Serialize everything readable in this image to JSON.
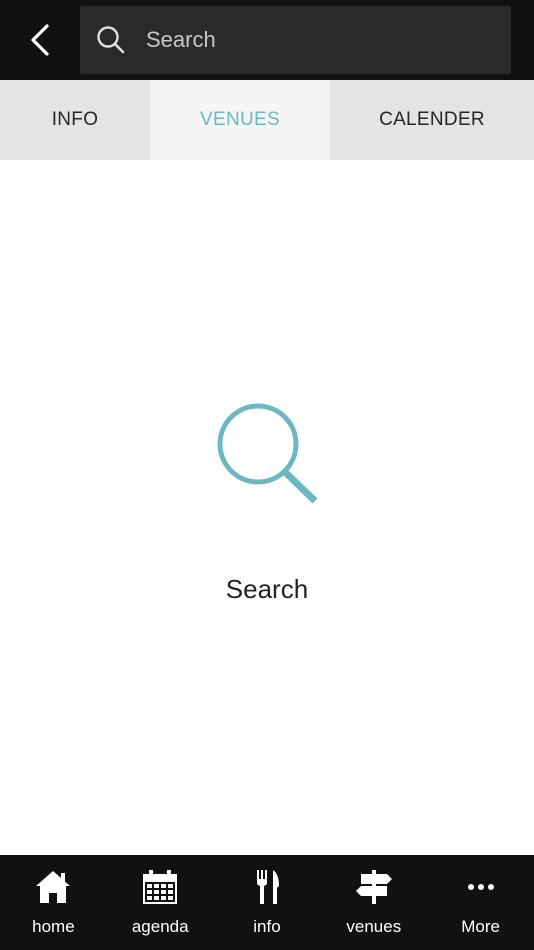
{
  "header": {
    "back_icon": "chevron-left-icon",
    "search": {
      "placeholder": "Search",
      "value": "",
      "icon": "search-icon"
    }
  },
  "tabs": [
    {
      "label": "INFO",
      "active": false
    },
    {
      "label": "VENUES",
      "active": true
    },
    {
      "label": "CALENDER",
      "active": false
    }
  ],
  "empty_state": {
    "icon": "search-icon",
    "label": "Search"
  },
  "bottom_nav": [
    {
      "label": "home",
      "icon": "home-icon"
    },
    {
      "label": "agenda",
      "icon": "calendar-icon"
    },
    {
      "label": "info",
      "icon": "fork-knife-icon"
    },
    {
      "label": "venues",
      "icon": "signpost-icon"
    },
    {
      "label": "More",
      "icon": "more-dots-icon"
    }
  ],
  "colors": {
    "accent": "#6cb8c0",
    "bar_background": "#111111",
    "search_field": "#2a2a2a",
    "tab_background": "#e4e4e4",
    "tab_active_background": "#f5f5f5"
  }
}
